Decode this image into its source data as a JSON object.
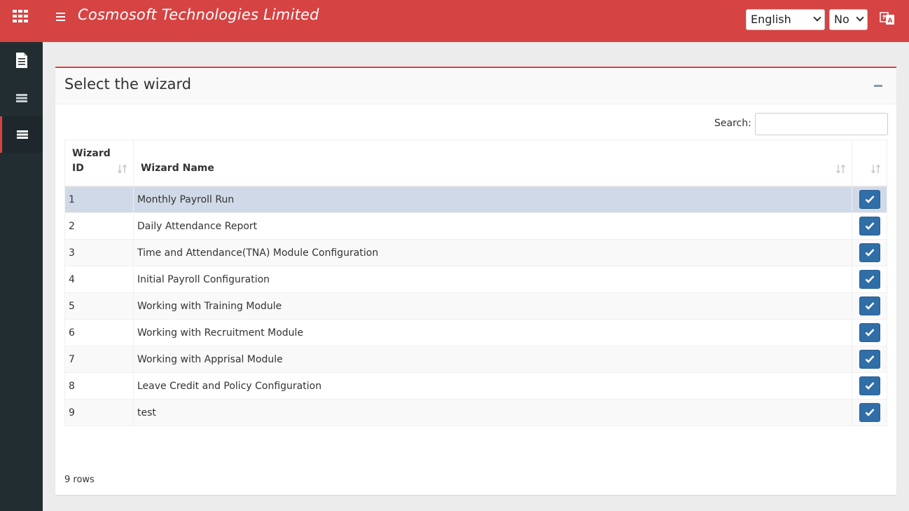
{
  "header": {
    "company_name": "Cosmosoft Technologies Limited",
    "language_select": "English",
    "second_select": "No"
  },
  "sidebar": {
    "items": [
      {
        "icon": "document-icon"
      },
      {
        "icon": "list-icon"
      },
      {
        "icon": "list-icon",
        "active": true
      }
    ]
  },
  "panel": {
    "title": "Select the wizard",
    "search_label": "Search:",
    "search_value": ""
  },
  "table": {
    "columns": [
      "Wizard\nID",
      "Wizard Name",
      ""
    ],
    "rows": [
      {
        "id": "1",
        "name": "Monthly Payroll Run"
      },
      {
        "id": "2",
        "name": "Daily Attendance Report"
      },
      {
        "id": "3",
        "name": "Time and Attendance(TNA) Module Configuration"
      },
      {
        "id": "4",
        "name": "Initial Payroll Configuration"
      },
      {
        "id": "5",
        "name": "Working with Training Module"
      },
      {
        "id": "6",
        "name": "Working with Recruitment Module"
      },
      {
        "id": "7",
        "name": "Working with Apprisal Module"
      },
      {
        "id": "8",
        "name": "Leave Credit and Policy Configuration"
      },
      {
        "id": "9",
        "name": "test"
      }
    ],
    "row_count_label": "9 rows"
  },
  "colors": {
    "brand": "#d64343",
    "sidebar": "#222d32",
    "action_button": "#2f6ea7",
    "selected_row": "#d0d9e7"
  }
}
